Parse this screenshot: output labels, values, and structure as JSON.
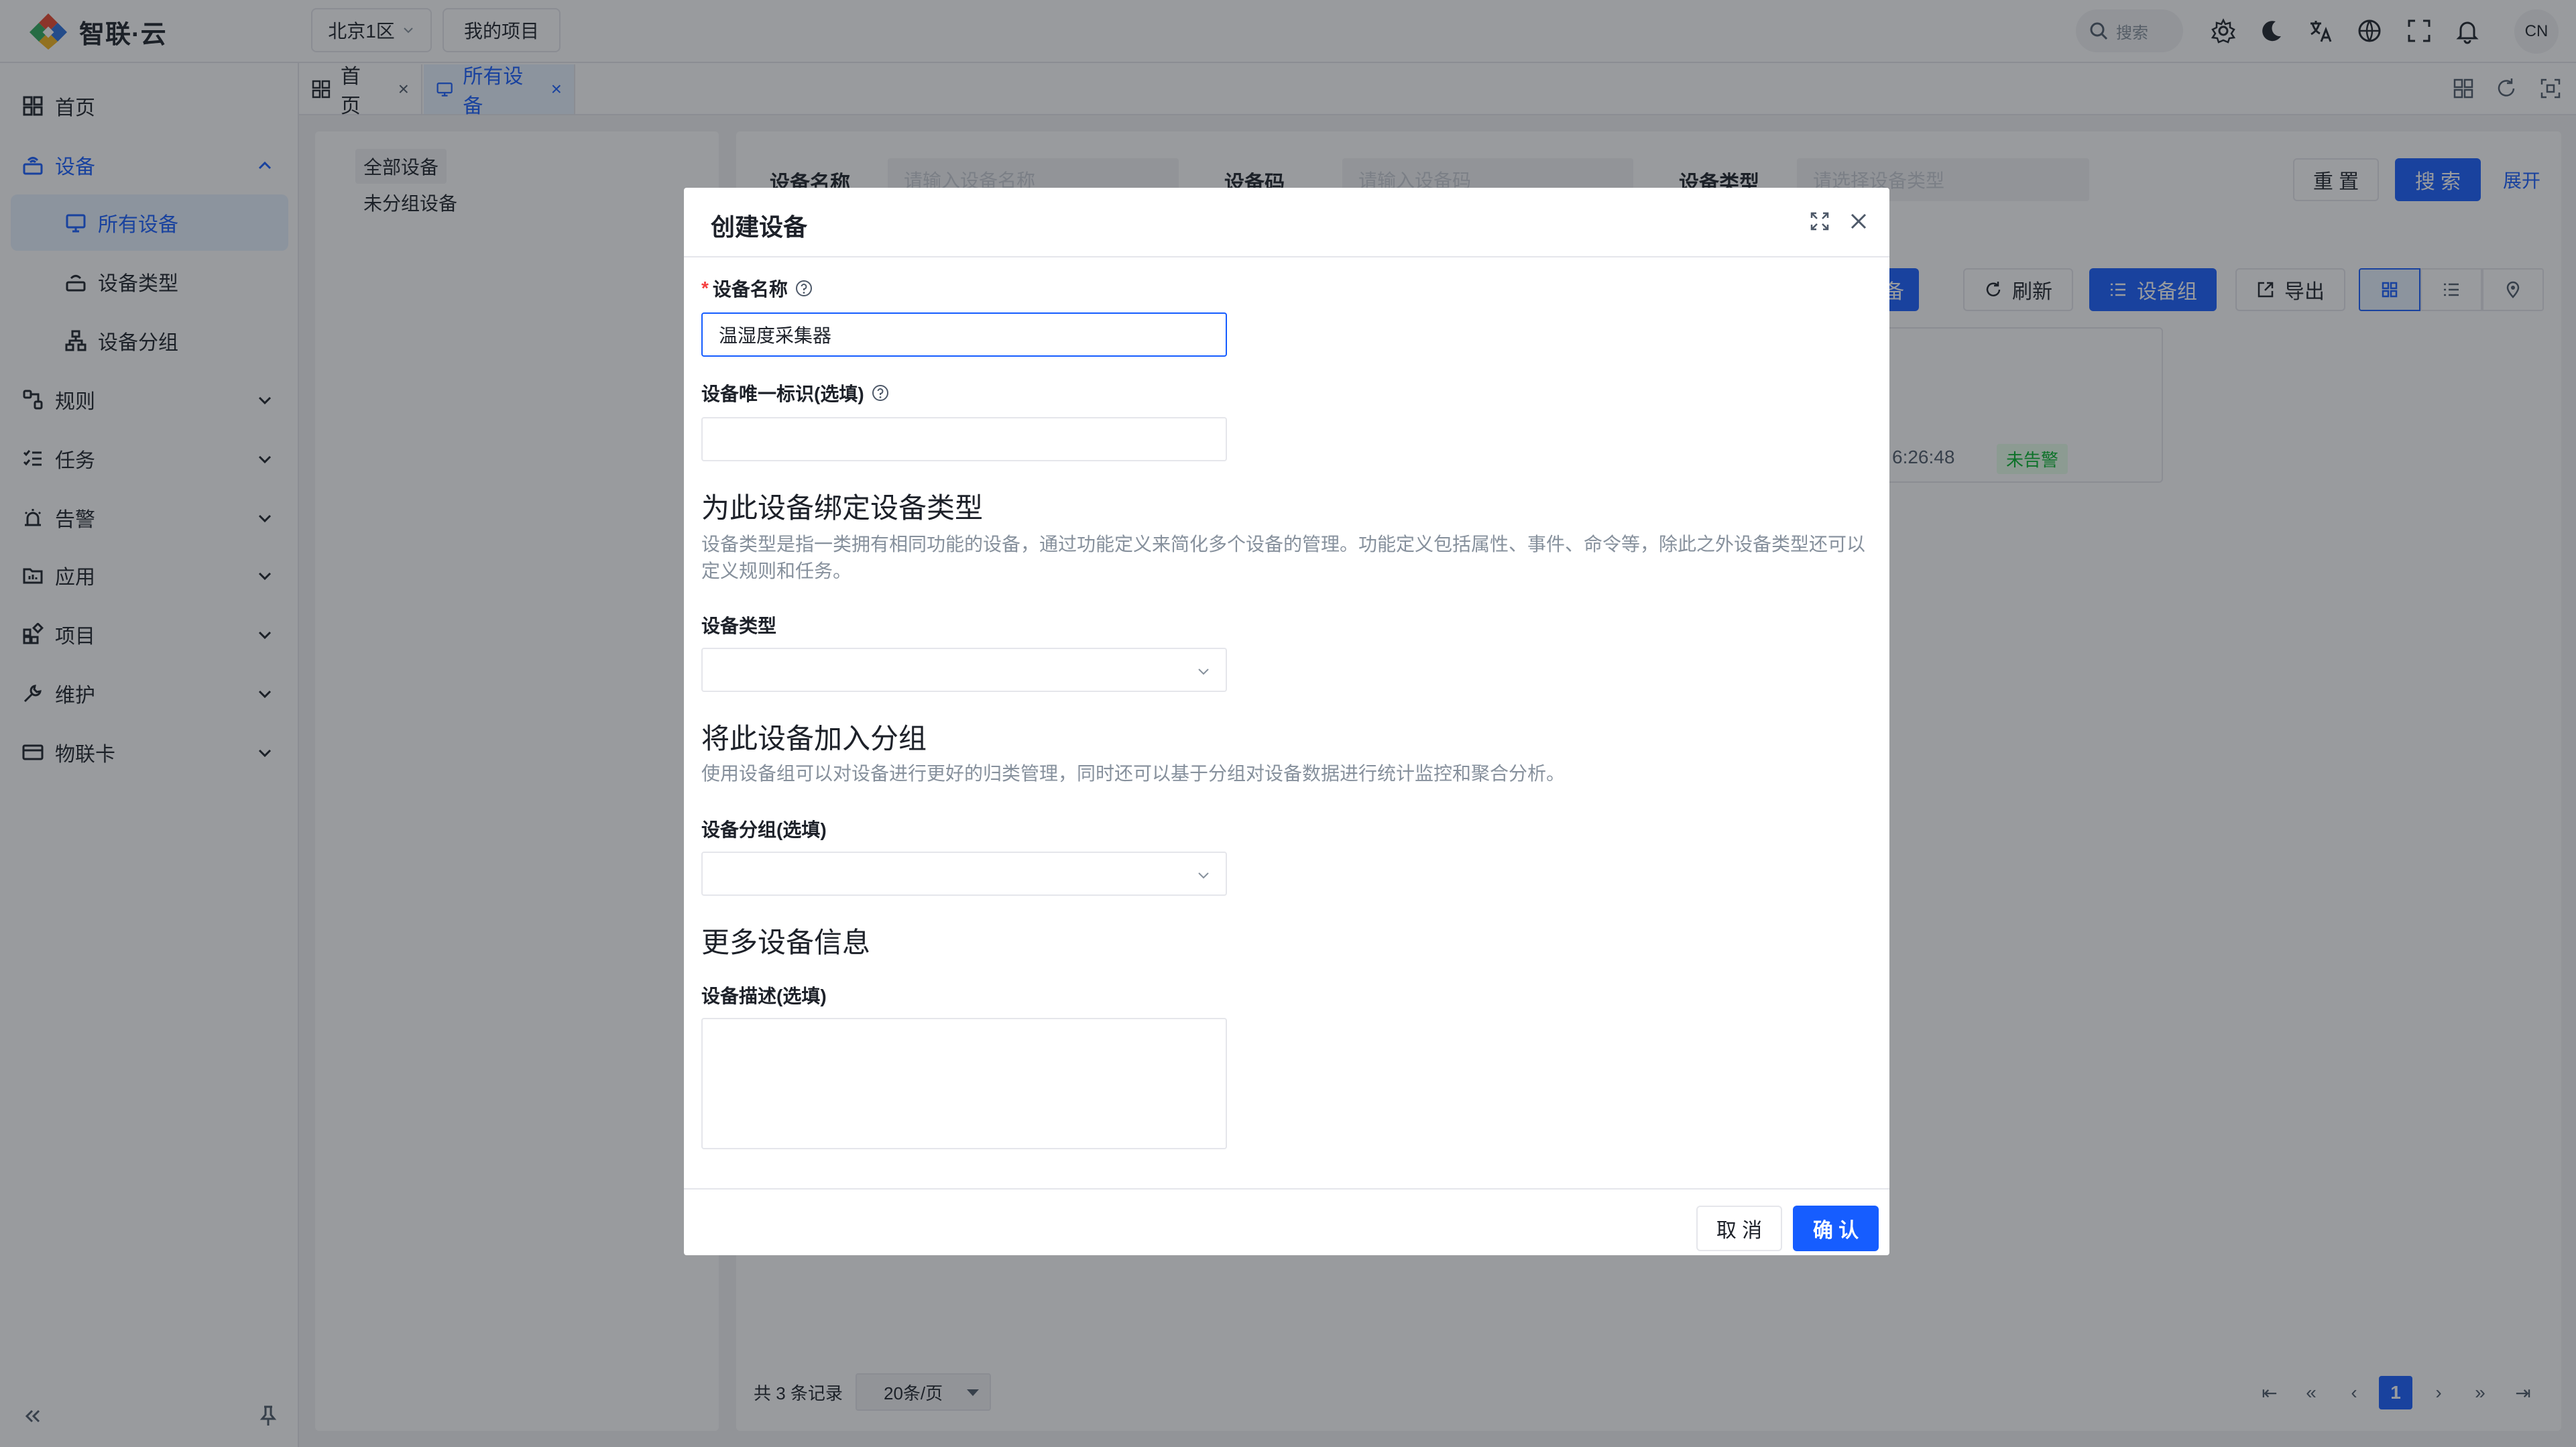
{
  "app": {
    "brand": "智联·云",
    "region": "北京1区",
    "my_project": "我的项目",
    "search_placeholder": "搜索",
    "lang": "CN"
  },
  "sidebar": {
    "items": [
      {
        "label": "首页",
        "icon": "dashboard-icon"
      },
      {
        "label": "设备",
        "icon": "device-icon",
        "expanded": true
      },
      {
        "label": "所有设备",
        "icon": "monitor-icon",
        "selected": true
      },
      {
        "label": "设备类型",
        "icon": "device-type-icon"
      },
      {
        "label": "设备分组",
        "icon": "group-icon"
      },
      {
        "label": "规则",
        "icon": "rule-icon"
      },
      {
        "label": "任务",
        "icon": "task-icon"
      },
      {
        "label": "告警",
        "icon": "alarm-icon"
      },
      {
        "label": "应用",
        "icon": "app-icon"
      },
      {
        "label": "项目",
        "icon": "project-icon"
      },
      {
        "label": "维护",
        "icon": "wrench-icon"
      },
      {
        "label": "物联卡",
        "icon": "card-icon"
      }
    ]
  },
  "tabs": [
    {
      "label": "首页",
      "closable": true
    },
    {
      "label": "所有设备",
      "closable": true,
      "active": true
    }
  ],
  "tree": {
    "all": "全部设备",
    "ungrouped": "未分组设备"
  },
  "filters": {
    "name_label": "设备名称",
    "name_placeholder": "请输入设备名称",
    "code_label": "设备码",
    "code_placeholder": "请输入设备码",
    "type_label": "设备类型",
    "type_placeholder": "请选择设备类型",
    "reset": "重 置",
    "search": "搜 索",
    "expand": "展开"
  },
  "toolbar": {
    "add_device": "设备",
    "refresh": "刷新",
    "device_group": "设备组",
    "export": "导出"
  },
  "card": {
    "time": "6:26:48",
    "status": "未告警"
  },
  "pagination": {
    "total": "共 3 条记录",
    "page_size": "20条/页",
    "current_page": "1"
  },
  "modal": {
    "title": "创建设备",
    "device_name_label": "设备名称",
    "device_name_value": "温湿度采集器",
    "device_id_label": "设备唯一标识(选填)",
    "device_id_value": "",
    "bind_type_title": "为此设备绑定设备类型",
    "bind_type_desc": "设备类型是指一类拥有相同功能的设备，通过功能定义来简化多个设备的管理。功能定义包括属性、事件、命令等，除此之外设备类型还可以定义规则和任务。",
    "device_type_label": "设备类型",
    "add_group_title": "将此设备加入分组",
    "add_group_desc": "使用设备组可以对设备进行更好的归类管理，同时还可以基于分组对设备数据进行统计监控和聚合分析。",
    "device_group_label": "设备分组(选填)",
    "more_info_title": "更多设备信息",
    "device_desc_label": "设备描述(选填)",
    "cancel": "取 消",
    "confirm": "确 认"
  },
  "colors": {
    "primary": "#165dff",
    "danger": "#f53f3f",
    "success": "#00b42a",
    "overlay": "rgba(29,33,41,0.45)"
  }
}
